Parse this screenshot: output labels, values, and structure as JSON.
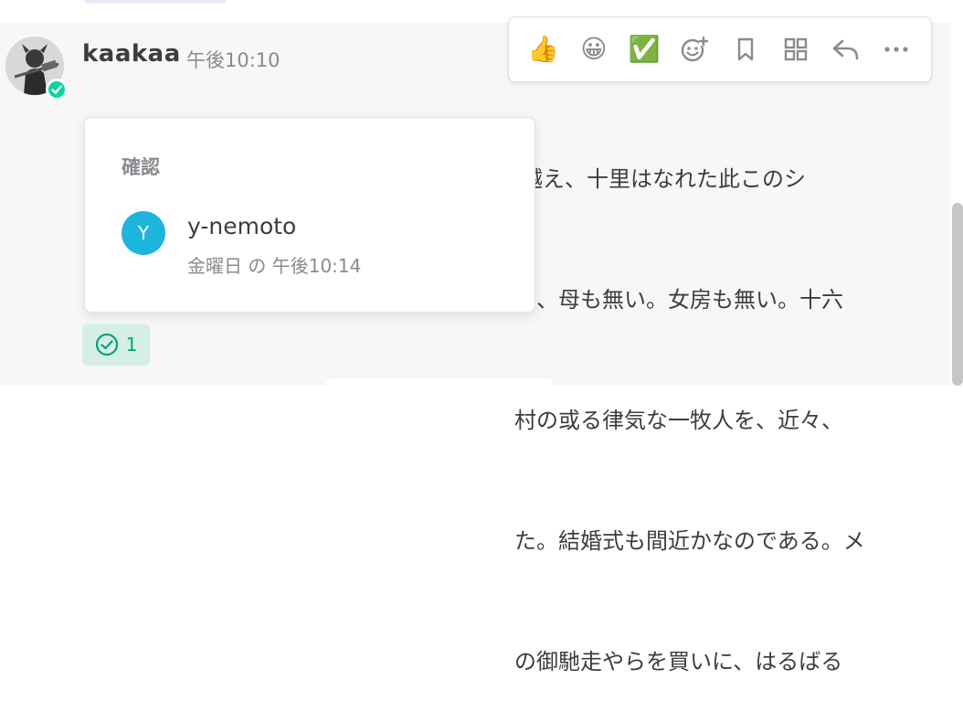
{
  "post": {
    "username": "kaakaa",
    "time": "午後10:10",
    "message_lines": [
      "きょう未明メロスは村を出発し、野を越え山越え、十里はなれた此このシ",
      "                                                              ら、母も無い。女房も無い。十六",
      "                                                              村の或る律気な一牧人を、近々、",
      "                                                              た。結婚式も間近かなのである。メ",
      "                                                              の御馳走やらを買いに、はるばる"
    ]
  },
  "toolbar": {
    "items": [
      {
        "name": "thumbsup",
        "glyph": "👍"
      },
      {
        "name": "grinning",
        "glyph": "😀"
      },
      {
        "name": "check",
        "glyph": "✅"
      }
    ]
  },
  "ack_popover": {
    "title": "確認",
    "user": {
      "initial": "Y",
      "name": "y-nemoto",
      "time": "金曜日 の 午後10:14"
    }
  },
  "ack_badge": {
    "count": "1"
  },
  "colors": {
    "accent_green": "#06d6a0",
    "user_avatar_bg": "#1bb5dd",
    "badge_bg": "#d5efe6"
  }
}
